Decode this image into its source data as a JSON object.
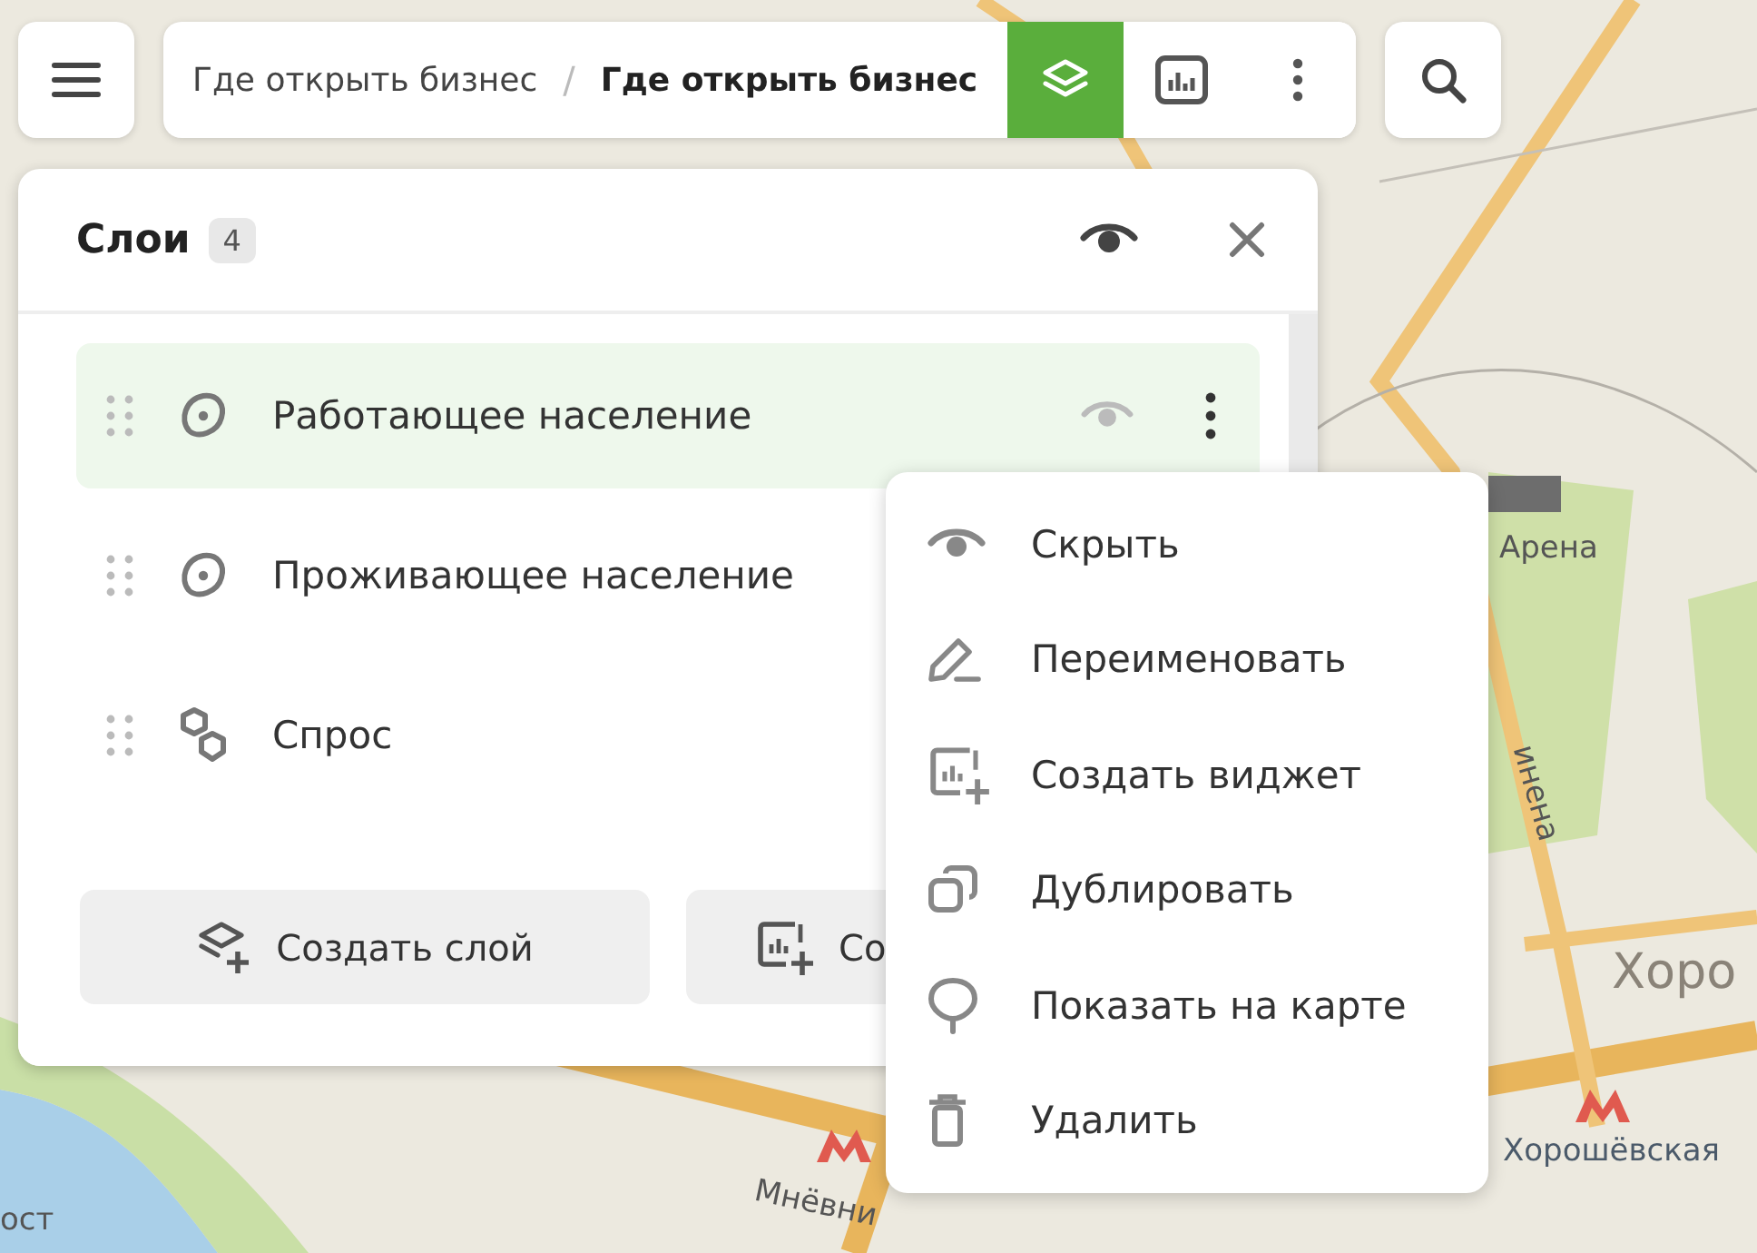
{
  "toolbar": {
    "breadcrumb": [
      {
        "label": "Где открыть бизнес",
        "current": false
      },
      {
        "label": "Где открыть бизнес",
        "current": true
      }
    ],
    "separator": "/",
    "layers_active": true
  },
  "layers_panel": {
    "title": "Слои",
    "count": "4",
    "items": [
      {
        "name": "Работающее население",
        "kind": "polygon",
        "selected": true
      },
      {
        "name": "Проживающее население",
        "kind": "polygon",
        "selected": false
      },
      {
        "name": "Спрос",
        "kind": "hexagons",
        "selected": false
      }
    ],
    "buttons": [
      {
        "label": "Создать слой",
        "kind": "layer"
      },
      {
        "label": "Со",
        "kind": "widget"
      }
    ]
  },
  "context_menu": {
    "items": [
      {
        "label": "Скрыть",
        "kind": "hide"
      },
      {
        "label": "Переименовать",
        "kind": "rename"
      },
      {
        "label": "Создать виджет",
        "kind": "widget"
      },
      {
        "label": "Дублировать",
        "kind": "duplicate"
      },
      {
        "label": "Показать на карте",
        "kind": "locate"
      },
      {
        "label": "Удалить",
        "kind": "delete"
      }
    ]
  },
  "map_labels": [
    {
      "text": "Арена",
      "kind": "place"
    },
    {
      "text": "Хоро",
      "kind": "district"
    },
    {
      "text": "Хорошёвская",
      "kind": "metro"
    },
    {
      "text": "Мнёвни",
      "kind": "street"
    },
    {
      "text": "инена",
      "kind": "street"
    },
    {
      "text": "ост",
      "kind": "place"
    }
  ]
}
